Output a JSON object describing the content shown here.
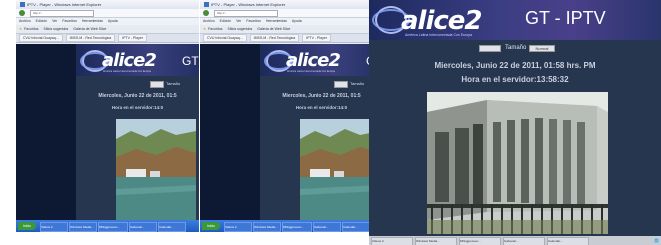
{
  "browser": {
    "window_title": "IPTV - Player - Windows Internet Explorer",
    "address": "http://...",
    "menu": [
      "Archivo",
      "Edición",
      "Ver",
      "Favoritos",
      "Herramientas",
      "Ayuda"
    ],
    "favorites_label": "Favoritos",
    "favorites": [
      "Sitios sugeridos",
      "Galería de Web Slice"
    ],
    "tabs": [
      "CVU Infovial Guayaq...",
      "IMSS-M - Red Tecnológica",
      "IPTV - Player"
    ]
  },
  "site": {
    "logo": "alice2",
    "logo_sub": "América Latina Interconectada Con Europa",
    "channel_title": "GT - IPTV",
    "channel_title_short": "GT",
    "control_label": "Tamaño",
    "control_value": "Normal",
    "date_text": "Miercoles, Junio 22 de 2011, 01:58 hrs. PM",
    "date_text_small": "Miercoles, Junio 22 de 2011, 01:5",
    "time_text": "Hora en el servidor:13:58:32",
    "time_text_small": "Hora en el servidor:14:0"
  },
  "taskbar": {
    "start": "Inicio",
    "items": [
      "Videos 2",
      "Windows Media...",
      "MiSiggrecuen...",
      "Galvanar...",
      "Calendar..."
    ]
  },
  "colors": {
    "page_bg": "#27364f",
    "header_bg": "#2d3574",
    "taskbar": "#2466cc"
  }
}
